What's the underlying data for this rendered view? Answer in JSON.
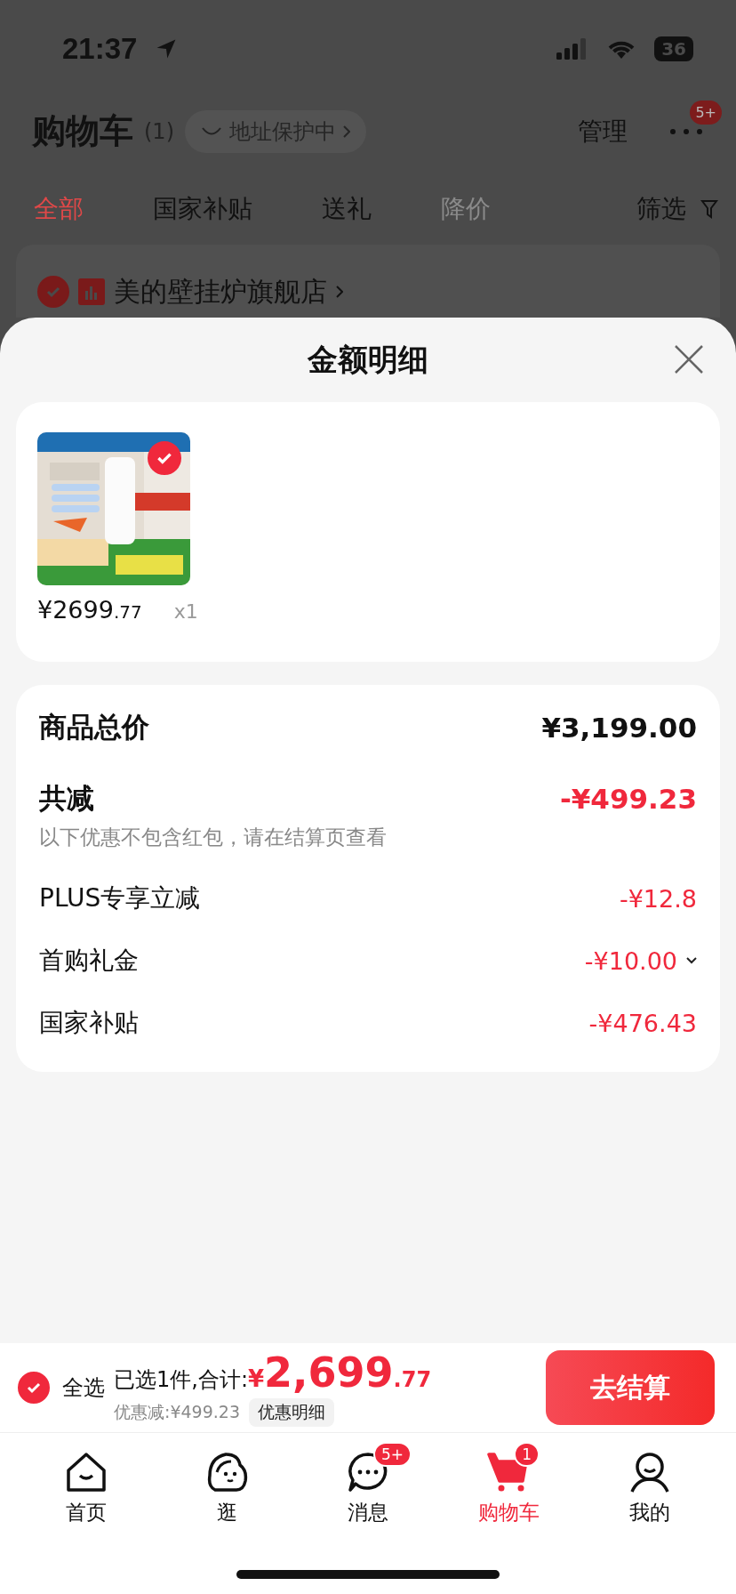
{
  "status_bar": {
    "time": "21:37",
    "battery": "36"
  },
  "header": {
    "title": "购物车",
    "count": "(1)",
    "address_badge": "地址保护中",
    "manage": "管理",
    "more_badge": "5+"
  },
  "tabs": [
    {
      "label": "全部",
      "selected": true,
      "disabled": false
    },
    {
      "label": "国家补贴",
      "selected": false,
      "disabled": false
    },
    {
      "label": "送礼",
      "selected": false,
      "disabled": false
    },
    {
      "label": "降价",
      "selected": false,
      "disabled": true
    }
  ],
  "filter": {
    "label": "筛选"
  },
  "store": {
    "name": "美的壁挂炉旗舰店",
    "checked": true
  },
  "sheet": {
    "title": "金额明细",
    "product": {
      "kind": "picture",
      "checked": true,
      "price_main": "¥2699",
      "price_decimal": ".77",
      "quantity": "x1"
    },
    "rows": [
      {
        "kind": "total",
        "label": "商品总价",
        "value": "¥3,199.00"
      },
      {
        "kind": "discount",
        "label": "共减",
        "value": "-¥499.23",
        "note": "以下优惠不包含红包，请在结算页查看"
      },
      {
        "kind": "item",
        "label": "PLUS专享立减",
        "value": "-¥12.8",
        "expandable": false
      },
      {
        "kind": "item",
        "label": "首购礼金",
        "value": "-¥10.00",
        "expandable": true
      },
      {
        "kind": "item",
        "label": "国家补贴",
        "value": "-¥476.43",
        "expandable": false
      }
    ]
  },
  "checkout": {
    "select_all": {
      "label": "全选",
      "checked": true
    },
    "summary": "已选1件,合计:",
    "currency": "¥",
    "total_main": "2,699",
    "total_decimal": ".77",
    "saved": "优惠减:¥499.23",
    "detail_button": "优惠明细",
    "button": "去结算"
  },
  "nav": [
    {
      "kind": "home",
      "label": "首页",
      "selected": false
    },
    {
      "kind": "browse",
      "label": "逛",
      "selected": false
    },
    {
      "kind": "messages",
      "label": "消息",
      "selected": false,
      "badge": "5+"
    },
    {
      "kind": "cart",
      "label": "购物车",
      "selected": true,
      "badge": "1"
    },
    {
      "kind": "profile",
      "label": "我的",
      "selected": false
    }
  ]
}
